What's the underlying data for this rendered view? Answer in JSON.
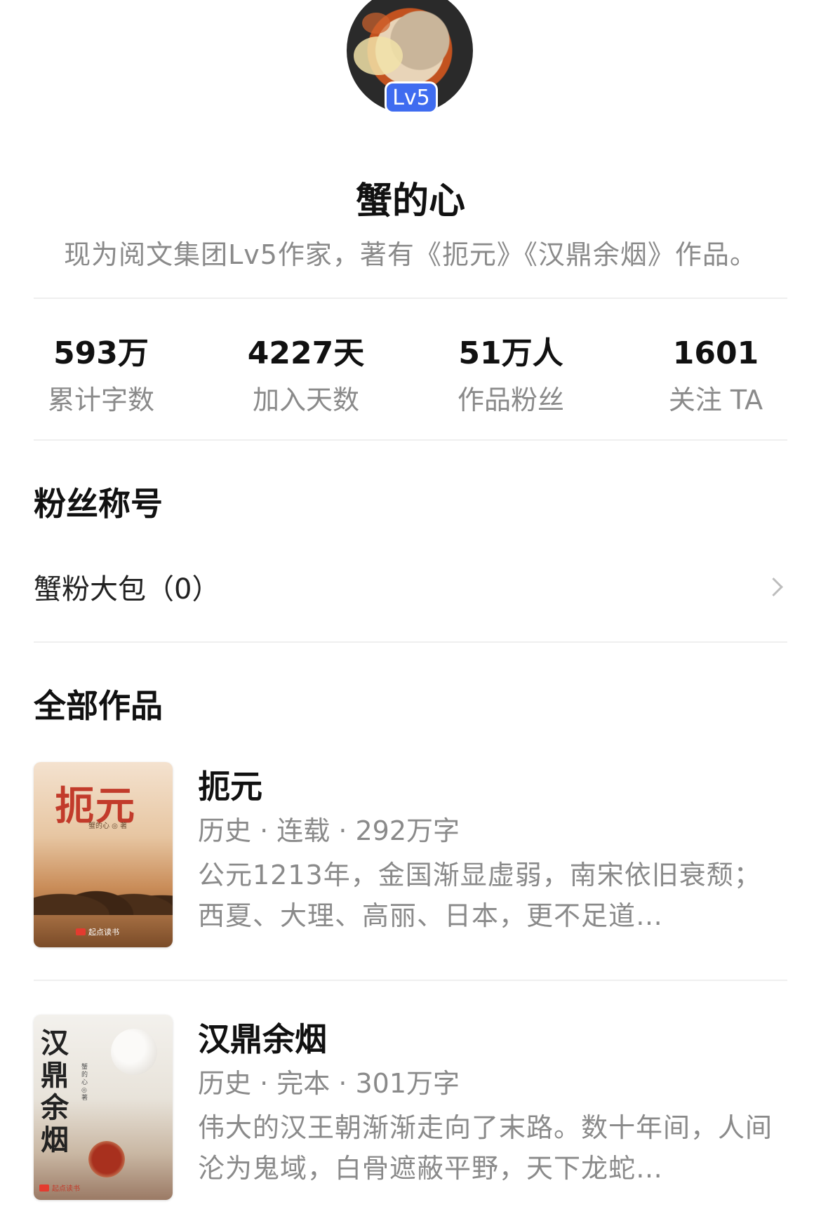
{
  "profile": {
    "level": "Lv5",
    "name": "蟹的心",
    "bio": "现为阅文集团Lv5作家，著有《扼元》《汉鼎余烟》作品。"
  },
  "stats": [
    {
      "value": "593万",
      "label": "累计字数"
    },
    {
      "value": "4227天",
      "label": "加入天数"
    },
    {
      "value": "51万人",
      "label": "作品粉丝"
    },
    {
      "value": "1601",
      "label": "关注 TA"
    }
  ],
  "fan_section": {
    "title": "粉丝称号",
    "item": "蟹粉大包（0）"
  },
  "works_section": {
    "title": "全部作品",
    "books": [
      {
        "title": "扼元",
        "meta": "历史 · 连载 · 292万字",
        "desc": "公元1213年，金国渐显虚弱，南宋依旧衰颓；西夏、大理、高丽、日本，更不足道…",
        "cover_title": "扼元",
        "cover_author": "蟹的心 ◎ 著",
        "cover_brand": "起点读书"
      },
      {
        "title": "汉鼎余烟",
        "meta": "历史 · 完本 · 301万字",
        "desc": "伟大的汉王朝渐渐走向了末路。数十年间，人间沦为鬼域，白骨遮蔽平野，天下龙蛇…",
        "cover_title": "汉鼎余烟",
        "cover_author": "蟹的心 ◎ 著",
        "cover_brand": "起点读书"
      }
    ]
  },
  "colors": {
    "accent": "#3f6cf0",
    "text_primary": "#111111",
    "text_secondary": "#8a8a8a",
    "divider": "#efefef"
  }
}
